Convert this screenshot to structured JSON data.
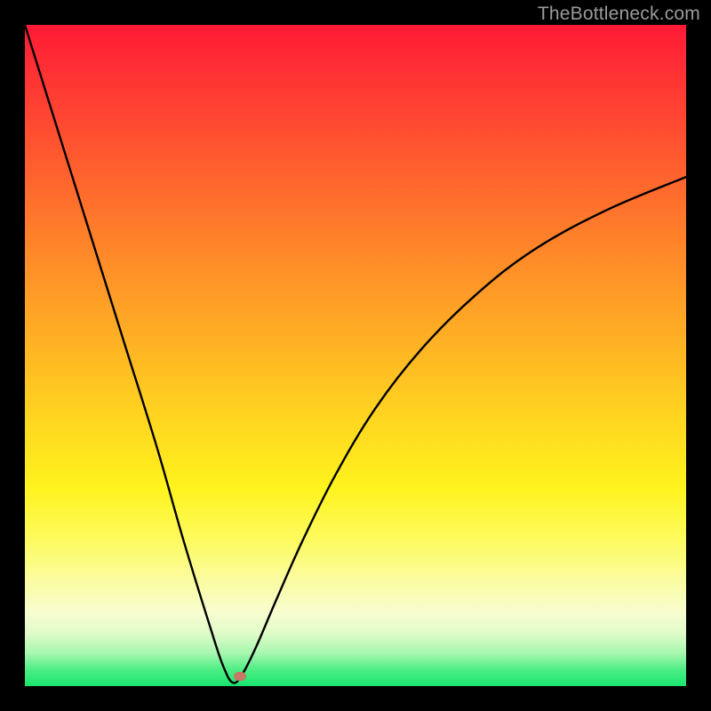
{
  "watermark": "TheBottleneck.com",
  "colors": {
    "frame": "#000000",
    "curve": "#000000",
    "marker": "#c57864",
    "gradient_top": "#ff1a35",
    "gradient_bottom": "#18e56e"
  },
  "chart_data": {
    "type": "line",
    "title": "",
    "xlabel": "",
    "ylabel": "",
    "xlim": [
      0,
      100
    ],
    "ylim": [
      0,
      100
    ],
    "grid": false,
    "legend": false,
    "series": [
      {
        "name": "bottleneck-curve",
        "x": [
          0,
          5,
          10,
          15,
          20,
          24,
          28,
          30,
          31.5,
          33,
          35,
          38,
          42,
          47,
          53,
          60,
          68,
          77,
          88,
          100
        ],
        "y": [
          100,
          84,
          68,
          52,
          36,
          22,
          9,
          3,
          0.5,
          2,
          6,
          13,
          22,
          32,
          42,
          51,
          59,
          66,
          72,
          77
        ]
      }
    ],
    "marker": {
      "x": 32.5,
      "y": 1.5
    }
  }
}
